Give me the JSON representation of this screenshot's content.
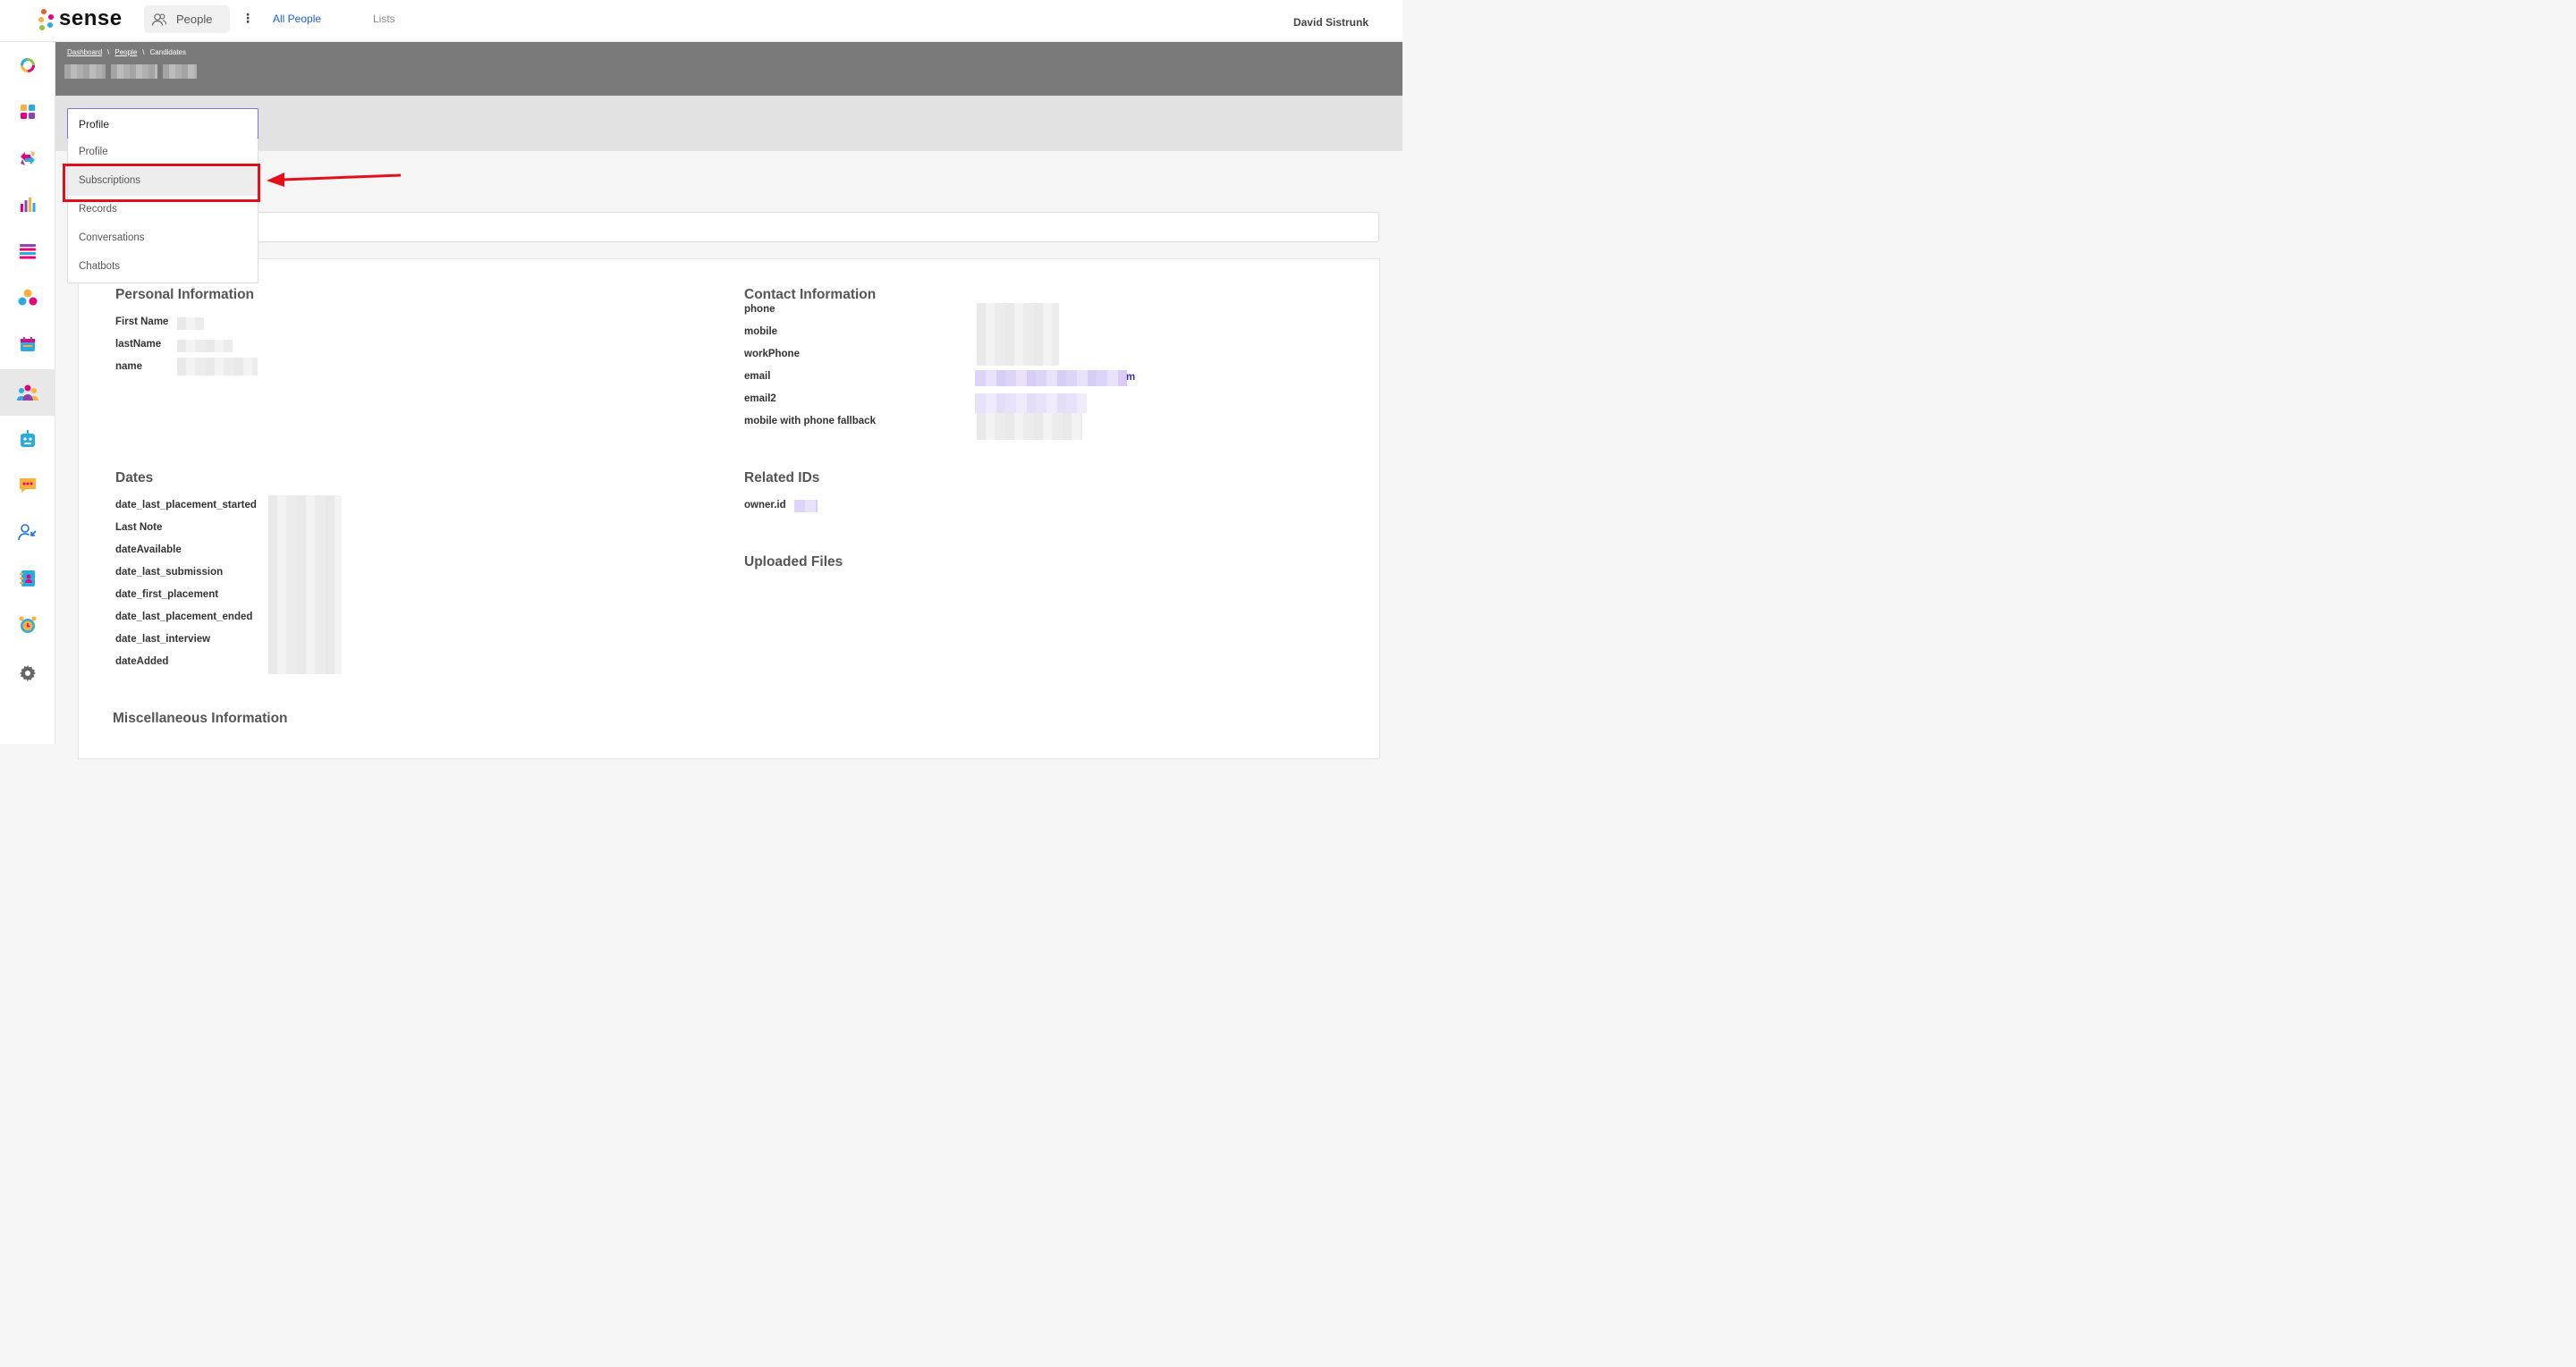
{
  "app": {
    "logo_text": "sense"
  },
  "topnav": {
    "section": "People",
    "kebab": "⋮",
    "tabs": [
      {
        "label": "All People"
      },
      {
        "label": "Lists"
      }
    ],
    "user": "David Sistrunk"
  },
  "sidebar": {
    "icons": [
      "dashboard-ring-icon",
      "apps-grid-icon",
      "sync-arrows-icon",
      "bar-chart-icon",
      "list-icon",
      "people-group-icon",
      "calendar-icon",
      "candidates-icon",
      "chatbot-icon",
      "chat-bubble-icon",
      "user-import-icon",
      "contacts-book-icon",
      "alarm-clock-icon",
      "gear-icon"
    ],
    "active_index": 7
  },
  "breadcrumb": {
    "items": [
      "Dashboard",
      "People",
      "Candidates"
    ],
    "separator": "\\"
  },
  "view_select": {
    "value": "Profile",
    "options": [
      "Profile",
      "Subscriptions",
      "Records",
      "Conversations",
      "Chatbots"
    ],
    "highlighted": "Subscriptions"
  },
  "personal": {
    "title": "Personal Information",
    "fields": [
      {
        "label": "First Name"
      },
      {
        "label": "lastName"
      },
      {
        "label": "name"
      }
    ]
  },
  "contact": {
    "title": "Contact Information",
    "fields": [
      {
        "label": "phone"
      },
      {
        "label": "mobile"
      },
      {
        "label": "workPhone"
      },
      {
        "label": "email"
      },
      {
        "label": "email2"
      },
      {
        "label": "mobile with phone fallback"
      }
    ],
    "email_visible_suffix": "m"
  },
  "dates": {
    "title": "Dates",
    "fields": [
      {
        "label": "date_last_placement_started"
      },
      {
        "label": "Last Note"
      },
      {
        "label": "dateAvailable"
      },
      {
        "label": "date_last_submission"
      },
      {
        "label": "date_first_placement"
      },
      {
        "label": "date_last_placement_ended"
      },
      {
        "label": "date_last_interview"
      },
      {
        "label": "dateAdded"
      }
    ]
  },
  "related": {
    "title": "Related IDs",
    "fields": [
      {
        "label": "owner.id"
      }
    ]
  },
  "uploaded": {
    "title": "Uploaded Files"
  },
  "misc": {
    "title": "Miscellaneous Information"
  },
  "colors": {
    "accent": "#1d5fd6",
    "annotation": "#e3101b",
    "header_gray": "#7a7a7a",
    "select_border": "#7b73c9"
  }
}
